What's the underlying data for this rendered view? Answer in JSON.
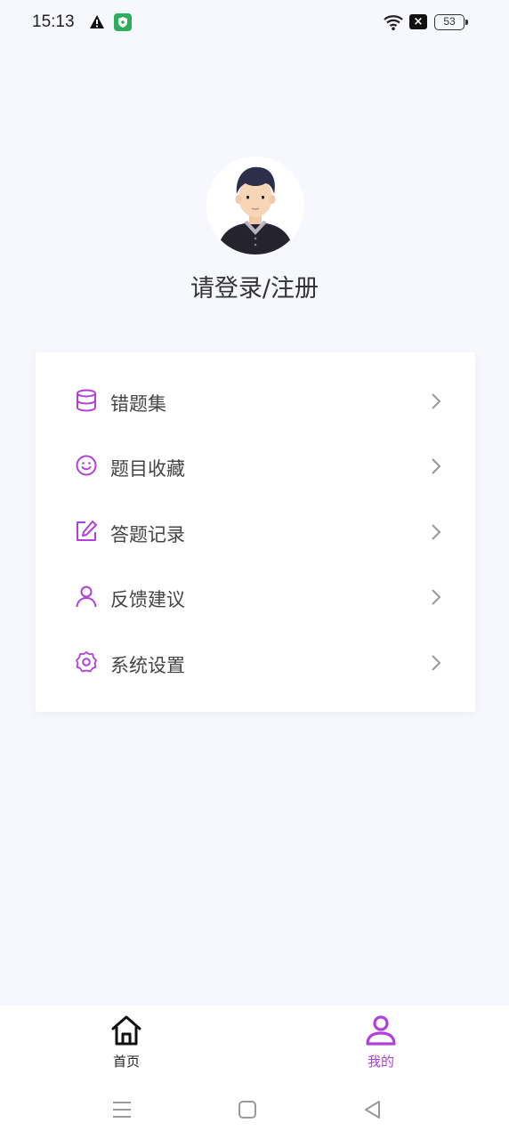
{
  "status_bar": {
    "time": "15:13",
    "sim_label": "×",
    "battery": "53"
  },
  "profile": {
    "login_prompt": "请登录/注册"
  },
  "menu": {
    "items": [
      {
        "label": "错题集",
        "icon": "database-icon"
      },
      {
        "label": "题目收藏",
        "icon": "smile-icon"
      },
      {
        "label": "答题记录",
        "icon": "edit-icon"
      },
      {
        "label": "反馈建议",
        "icon": "user-icon"
      },
      {
        "label": "系统设置",
        "icon": "settings-icon"
      }
    ]
  },
  "tab_bar": {
    "home": "首页",
    "mine": "我的"
  },
  "colors": {
    "accent": "#b13fdc",
    "background": "#f7f8fd",
    "text": "#444444"
  }
}
